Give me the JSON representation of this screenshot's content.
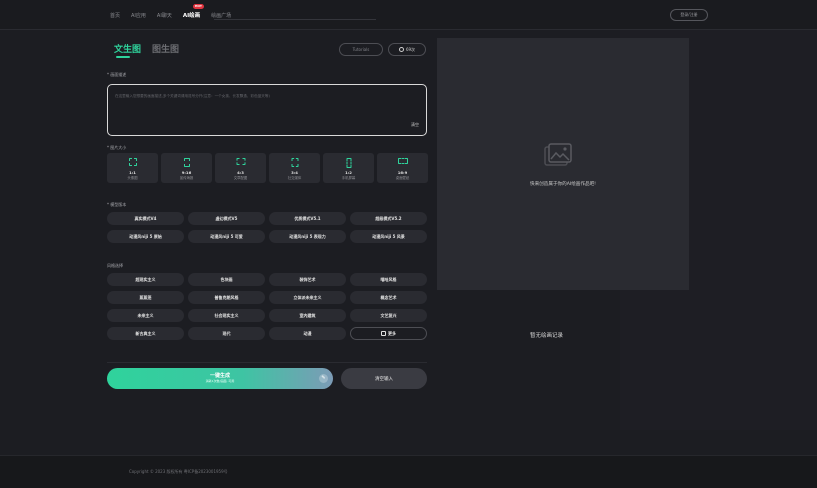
{
  "nav": {
    "items": [
      "首页",
      "AI应用",
      "AI聊天",
      "AI绘画",
      "绘画广场"
    ],
    "hot_badge": "HOT",
    "login": "登录/注册"
  },
  "tabs": {
    "active": "文生图",
    "inactive": "图生图"
  },
  "top_pills": {
    "left": "Tutorials",
    "right": "69次"
  },
  "prompt": {
    "label": "* 画面描述",
    "placeholder": "在这里输入您想要的画面描述,多个关键词请用逗号分开(注意：一个女孩、长发飘逸、彩色蓝天等)",
    "clear": "清空"
  },
  "size": {
    "label": "* 图片大小",
    "options": [
      {
        "ratio": "1:1",
        "name": "头像图"
      },
      {
        "ratio": "9:16",
        "name": "宣传海报"
      },
      {
        "ratio": "4:3",
        "name": "文章配图"
      },
      {
        "ratio": "3:4",
        "name": "社交媒体"
      },
      {
        "ratio": "1:2",
        "name": "手机屏幕"
      },
      {
        "ratio": "16:9",
        "name": "桌面壁纸"
      }
    ]
  },
  "model": {
    "label": "* 模型版本",
    "options": [
      "真实模式V4",
      "虚幻模式V5",
      "优质模式V5.1",
      "超级模式V5.2",
      "动漫风niji 5 原始",
      "动漫风niji 5 可爱",
      "动漫风niji 5 表现力",
      "动漫风niji 5 风景"
    ]
  },
  "style": {
    "label": "风格选择",
    "options": [
      "超现实主义",
      "色块画",
      "装饰艺术",
      "嘻哈风格",
      "蒸蒸笼",
      "普鲁克朗风格",
      "立体派未来主义",
      "概念艺术",
      "未来主义",
      "社会现实主义",
      "室内建筑",
      "文艺复兴",
      "新古典主义",
      "现代",
      "动漫"
    ],
    "more": "更多"
  },
  "generate": {
    "title": "一键生成",
    "subtitle": "消耗1次数/画面, 可用"
  },
  "clear_input": "清空输入",
  "right": {
    "hint": "快来创造属于你的AI绘画作品吧!",
    "no_record": "暂无绘画记录"
  },
  "footer": {
    "copyright": "Copyright © 2023 版权所有 粤ICP备2023001959号"
  }
}
